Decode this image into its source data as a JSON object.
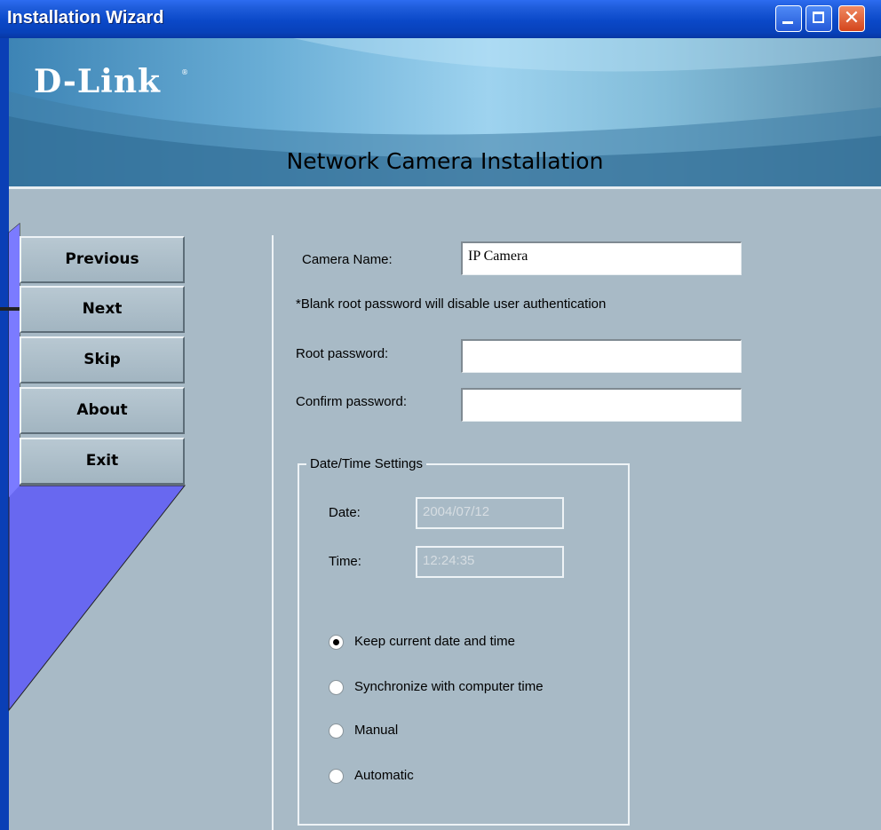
{
  "window": {
    "title": "Installation Wizard"
  },
  "header": {
    "logo": "D-Link",
    "logo_mark": "®",
    "title": "Network Camera Installation"
  },
  "nav": {
    "buttons": [
      {
        "label": "Previous"
      },
      {
        "label": "Next"
      },
      {
        "label": "Skip"
      },
      {
        "label": "About"
      },
      {
        "label": "Exit"
      }
    ]
  },
  "form": {
    "camera_name_label": "Camera Name:",
    "camera_name_value": "IP Camera",
    "note": "*Blank root password will disable user authentication",
    "root_password_label": "Root password:",
    "root_password_value": "",
    "confirm_password_label": "Confirm password:",
    "confirm_password_value": ""
  },
  "datetime": {
    "legend": "Date/Time Settings",
    "date_label": "Date:",
    "date_value": "2004/07/12",
    "time_label": "Time:",
    "time_value": "12:24:35",
    "options": [
      {
        "label": "Keep current date and time",
        "checked": true
      },
      {
        "label": "Synchronize with computer time",
        "checked": false
      },
      {
        "label": "Manual",
        "checked": false
      },
      {
        "label": "Automatic",
        "checked": false
      }
    ]
  },
  "colors": {
    "panel": "#a8bac6",
    "titlebar": "#0a48c8",
    "highlight": "#5a5ae6"
  }
}
